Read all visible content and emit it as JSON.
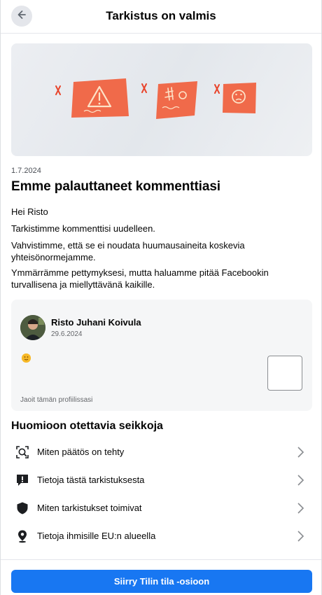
{
  "header": {
    "title": "Tarkistus on valmis",
    "back_icon": "arrow-left-icon"
  },
  "hero": {
    "icons": [
      "warning-icon",
      "scribble-icon",
      "sad-face-icon"
    ],
    "accent_color": "#f06a4a",
    "mark_color": "#e8452c"
  },
  "notice": {
    "date": "1.7.2024",
    "title": "Emme palauttaneet kommenttiasi",
    "greeting": "Hei Risto",
    "p1": "Tarkistimme kommenttisi uudelleen.",
    "p2": "Vahvistimme, että se ei noudata huumausaineita koskevia yhteisönormejamme.",
    "p3": "Ymmärrämme pettymyksesi, mutta haluamme pitää Facebookin turvallisena ja miellyttävänä kaikille."
  },
  "post": {
    "author": "Risto Juhani Koivula",
    "date": "29.6.2024",
    "shared_text": "Jaoit tämän profiilissasi",
    "emoji_icon": "smiley-emoji-icon"
  },
  "considerations": {
    "title": "Huomioon otettavia seikkoja",
    "items": [
      {
        "label": "Miten päätös on tehty",
        "icon": "magnifier-person-icon"
      },
      {
        "label": "Tietoja tästä tarkistuksesta",
        "icon": "alert-message-icon"
      },
      {
        "label": "Miten tarkistukset toimivat",
        "icon": "shield-icon"
      },
      {
        "label": "Tietoja ihmisille EU:n alueella",
        "icon": "location-pin-icon"
      }
    ]
  },
  "footer": {
    "cta_label": "Siirry Tilin tila -osioon",
    "cta_color": "#1877f2"
  }
}
